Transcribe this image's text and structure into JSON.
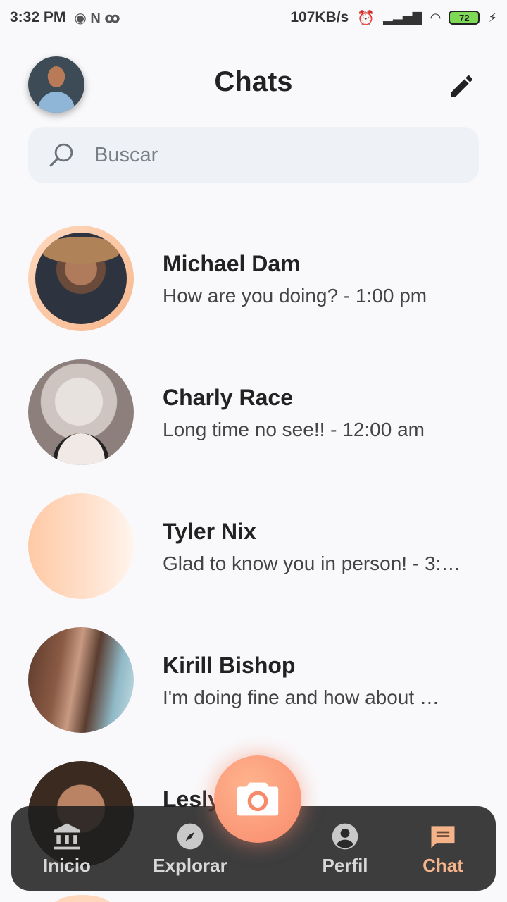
{
  "status_bar": {
    "time": "3:32 PM",
    "net_speed": "107KB/s",
    "battery": "72"
  },
  "header": {
    "title": "Chats",
    "avatar_icon": "user-avatar-photo",
    "edit_icon": "pencil-icon"
  },
  "search": {
    "placeholder": "Buscar",
    "icon": "search-icon"
  },
  "chats": [
    {
      "name": "Michael Dam",
      "preview": "How are you doing? - 1:00 pm"
    },
    {
      "name": "Charly Race",
      "preview": "Long time no see!! - 12:00 am"
    },
    {
      "name": "Tyler Nix",
      "preview": "Glad to know you in person! - 3:…"
    },
    {
      "name": "Kirill Bishop",
      "preview": "I'm doing fine and how about …"
    },
    {
      "name": "Lesly",
      "preview": ""
    }
  ],
  "nav": {
    "items": [
      {
        "label": "Inicio",
        "icon": "bank-icon"
      },
      {
        "label": "Explorar",
        "icon": "compass-icon"
      },
      {
        "label": "Perfil",
        "icon": "account-circle-icon"
      },
      {
        "label": "Chat",
        "icon": "chat-bubble-icon"
      }
    ],
    "active": "Chat",
    "fab_icon": "camera-icon"
  },
  "colors": {
    "accent": "#f5b38a",
    "fab": "#f88a6c",
    "nav_bg": "#1e1e1e",
    "search_bg": "#eef1f5"
  }
}
